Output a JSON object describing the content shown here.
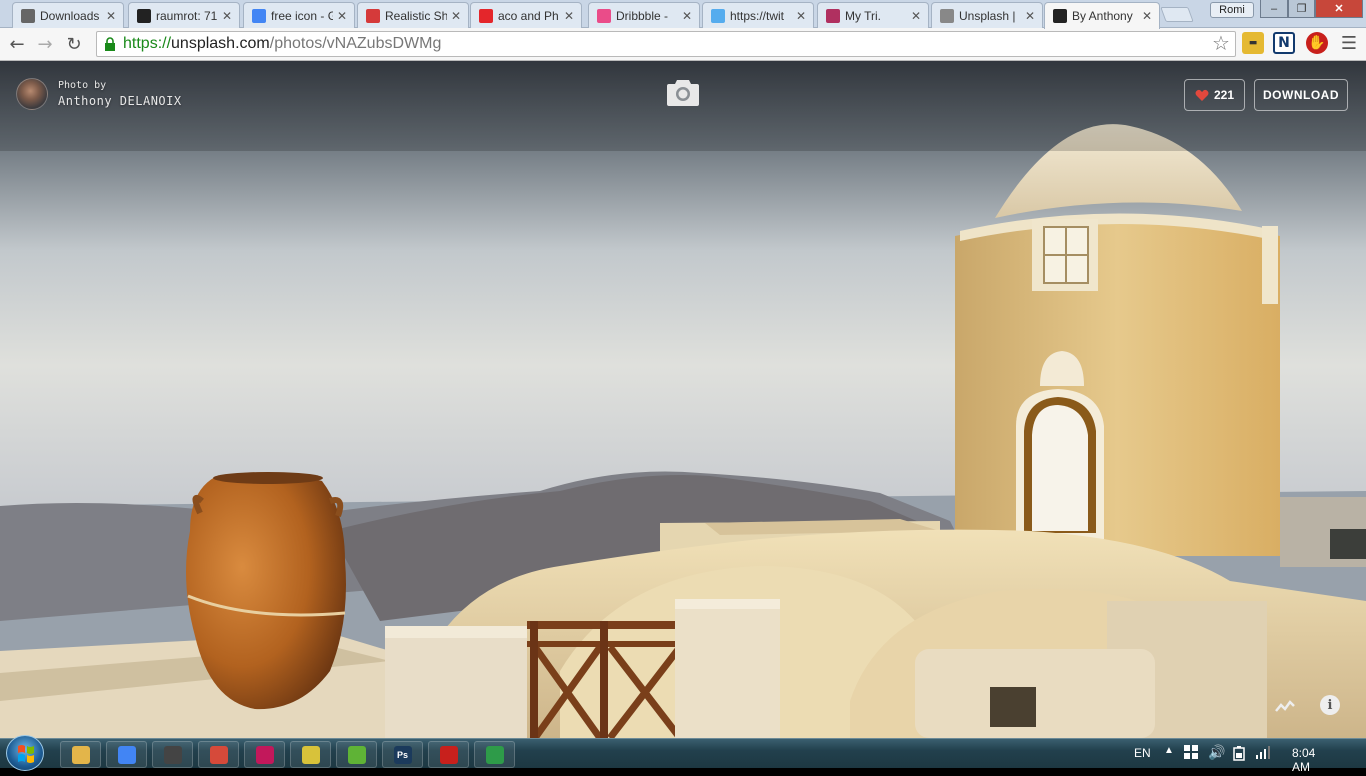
{
  "browser": {
    "tabs": [
      {
        "label": "Downloads",
        "icon": "download-icon",
        "color": "#666666"
      },
      {
        "label": "raumrot: 71",
        "icon": "raumrot-icon",
        "color": "#222222"
      },
      {
        "label": "free icon - G",
        "icon": "google-icon",
        "color": "#4285f4"
      },
      {
        "label": "Realistic Sh",
        "icon": "realistic-icon",
        "color": "#d53a3a"
      },
      {
        "label": "aco and Ph",
        "icon": "adobe-icon",
        "color": "#e4262b"
      },
      {
        "label": "Dribbble - ",
        "icon": "dribbble-icon",
        "color": "#ea4c89"
      },
      {
        "label": "https://twit",
        "icon": "twitter-icon",
        "color": "#55acee"
      },
      {
        "label": "My Tri.",
        "icon": "tri-icon",
        "color": "#b03060"
      },
      {
        "label": "Unsplash | ",
        "icon": "page-icon",
        "color": "#888888"
      },
      {
        "label": "By Anthony",
        "icon": "camera-icon",
        "color": "#222222"
      }
    ],
    "user_label": "Romi",
    "url_scheme": "https://",
    "url_host": "unsplash.com",
    "url_path": "/photos/vNAZubsDWMg"
  },
  "page": {
    "credit_small": "Photo by",
    "credit_name": "Anthony DELANOIX",
    "likes": "221",
    "download_label": "DOWNLOAD"
  },
  "taskbar": {
    "apps": [
      {
        "name": "explorer",
        "icon": "folder-icon",
        "color": "#e3b54a"
      },
      {
        "name": "chrome",
        "icon": "chrome-icon",
        "color": "#4285f4"
      },
      {
        "name": "media",
        "icon": "clapper-icon",
        "color": "#444444"
      },
      {
        "name": "app-red",
        "icon": "red-app-icon",
        "color": "#d64a3a"
      },
      {
        "name": "app-circle",
        "icon": "circle-app-icon",
        "color": "#c2185b"
      },
      {
        "name": "app-yellow",
        "icon": "yellow-app-icon",
        "color": "#d8c23a"
      },
      {
        "name": "evernote",
        "icon": "evernote-icon",
        "color": "#5fb336"
      },
      {
        "name": "photoshop",
        "icon": "photoshop-icon",
        "color": "#1b3a5c",
        "text": "Ps"
      },
      {
        "name": "acrobat",
        "icon": "acrobat-icon",
        "color": "#c8201c"
      },
      {
        "name": "sheets",
        "icon": "spreadsheet-icon",
        "color": "#2e9b49"
      }
    ],
    "lang": "EN",
    "time": "8:04 AM"
  }
}
